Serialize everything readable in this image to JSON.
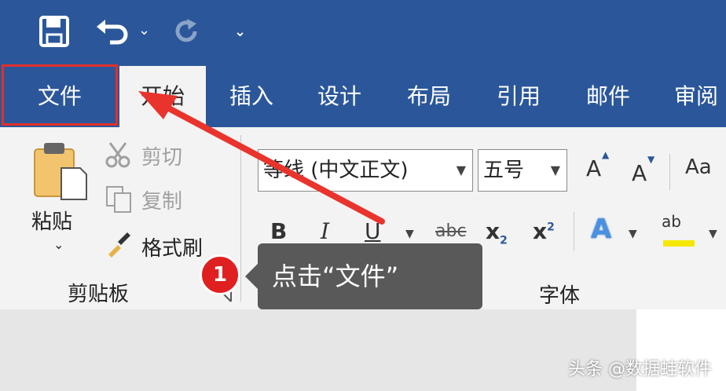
{
  "quick_access": {
    "save_icon": "save-icon",
    "undo_icon": "undo-icon",
    "undo_dropdown": "⌄",
    "redo_icon": "redo-icon",
    "customize": "⌄"
  },
  "tabs": [
    {
      "label": "文件"
    },
    {
      "label": "开始"
    },
    {
      "label": "插入"
    },
    {
      "label": "设计"
    },
    {
      "label": "布局"
    },
    {
      "label": "引用"
    },
    {
      "label": "邮件"
    },
    {
      "label": "审阅"
    }
  ],
  "clipboard": {
    "paste_label": "粘贴",
    "paste_dropdown": "⌄",
    "cut_label": "剪切",
    "copy_label": "复制",
    "format_painter_label": "格式刷",
    "group_label": "剪贴板"
  },
  "font": {
    "font_name": "等线 (中文正文)",
    "font_size": "五号",
    "grow_label": "A",
    "shrink_label": "A",
    "case_label": "Aa",
    "bold": "B",
    "italic": "I",
    "underline": "U",
    "strike": "abc",
    "subscript": "x",
    "subscript_mark": "2",
    "superscript": "x",
    "superscript_mark": "2",
    "effects_label": "A",
    "highlight_label": "ab",
    "group_label": "字体"
  },
  "annotation": {
    "badge": "1",
    "tooltip": "点击“文件”"
  },
  "watermark": "头条 @数据蛙软件",
  "colors": {
    "title_bar": "#2b579a",
    "highlight_box": "#e0302a",
    "arrow": "#e8342c",
    "tooltip_bg": "#595959",
    "badge_bg": "#e02020"
  }
}
